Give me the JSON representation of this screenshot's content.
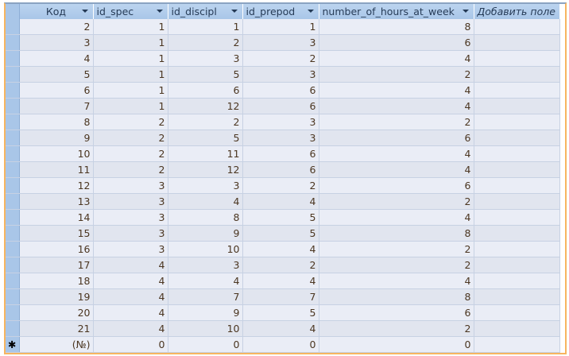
{
  "columns": [
    "Код",
    "id_spec",
    "id_discipl",
    "id_prepod",
    "number_of_hours_at_week",
    "Добавить поле"
  ],
  "rows": [
    [
      "2",
      "1",
      "1",
      "1",
      "8"
    ],
    [
      "3",
      "1",
      "2",
      "3",
      "6"
    ],
    [
      "4",
      "1",
      "3",
      "2",
      "4"
    ],
    [
      "5",
      "1",
      "5",
      "3",
      "2"
    ],
    [
      "6",
      "1",
      "6",
      "6",
      "4"
    ],
    [
      "7",
      "1",
      "12",
      "6",
      "4"
    ],
    [
      "8",
      "2",
      "2",
      "3",
      "2"
    ],
    [
      "9",
      "2",
      "5",
      "3",
      "6"
    ],
    [
      "10",
      "2",
      "11",
      "6",
      "4"
    ],
    [
      "11",
      "2",
      "12",
      "6",
      "4"
    ],
    [
      "12",
      "3",
      "3",
      "2",
      "6"
    ],
    [
      "13",
      "3",
      "4",
      "4",
      "2"
    ],
    [
      "14",
      "3",
      "8",
      "5",
      "4"
    ],
    [
      "15",
      "3",
      "9",
      "5",
      "8"
    ],
    [
      "16",
      "3",
      "10",
      "4",
      "2"
    ],
    [
      "17",
      "4",
      "3",
      "2",
      "2"
    ],
    [
      "18",
      "4",
      "4",
      "4",
      "4"
    ],
    [
      "19",
      "4",
      "7",
      "7",
      "8"
    ],
    [
      "20",
      "4",
      "9",
      "5",
      "6"
    ],
    [
      "21",
      "4",
      "10",
      "4",
      "2"
    ]
  ],
  "new_row": {
    "marker": "✱",
    "values": [
      "(№)",
      "0",
      "0",
      "0",
      "0"
    ]
  }
}
